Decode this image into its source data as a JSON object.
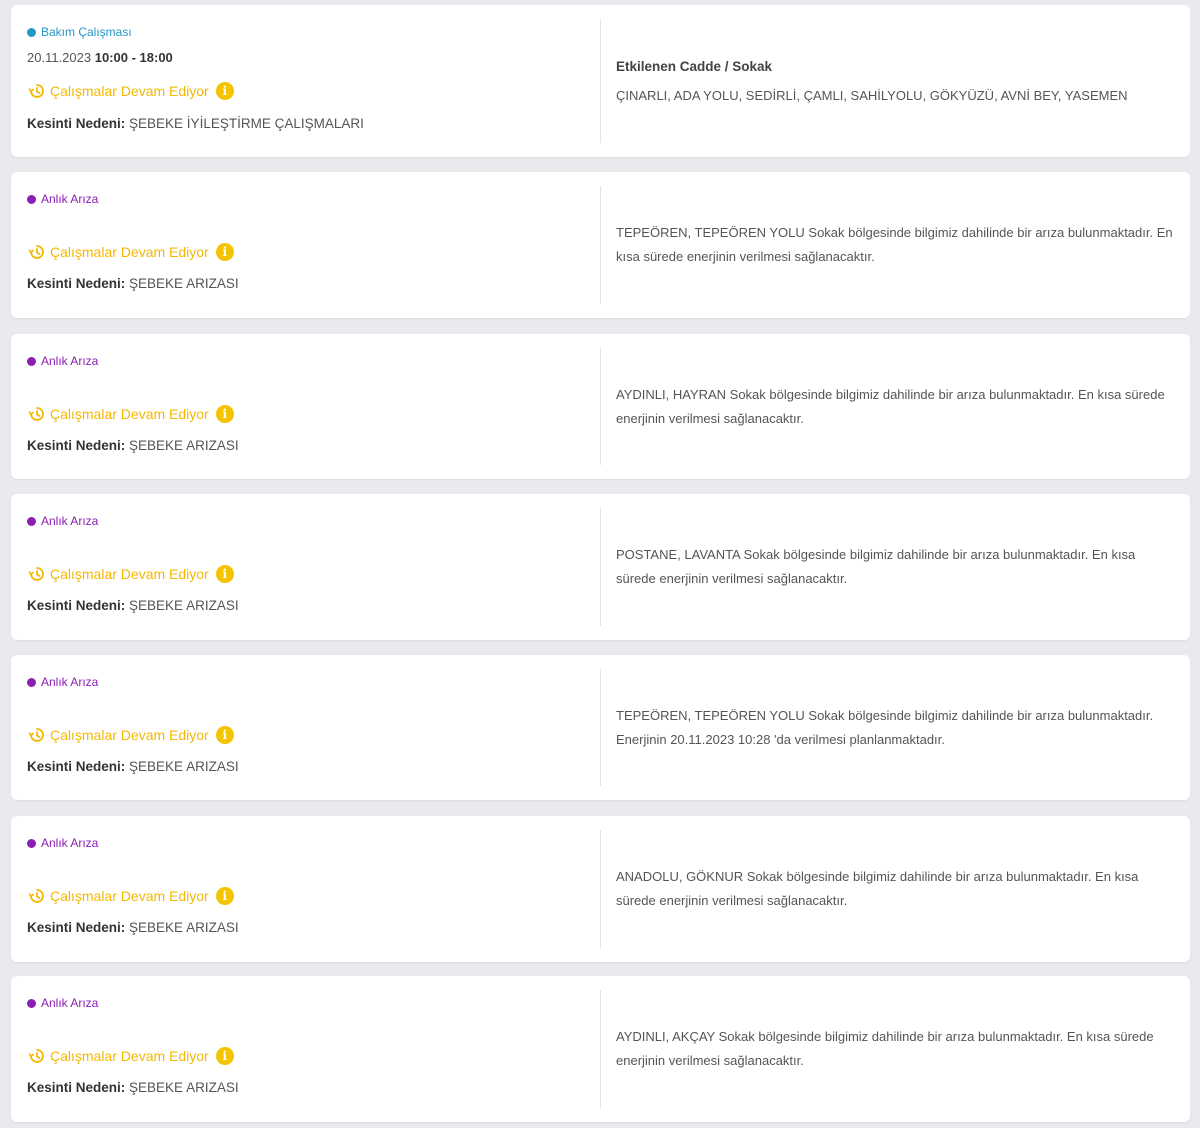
{
  "maintenance": {
    "type_label": "Bakım Çalışması",
    "date": "20.11.2023",
    "time": "10:00 - 18:00",
    "status": "Çalışmalar Devam Ediyor",
    "reason_label": "Kesinti Nedeni:",
    "reason": "ŞEBEKE İYİLEŞTİRME ÇALIŞMALARI",
    "affected_title": "Etkilenen Cadde / Sokak",
    "affected_list": "ÇINARLI, ADA YOLU, SEDİRLİ, ÇAMLI, SAHİLYOLU, GÖKYÜZÜ, AVNİ BEY, YASEMEN"
  },
  "faults": [
    {
      "type_label": "Anlık Arıza",
      "status": "Çalışmalar Devam Ediyor",
      "reason_label": "Kesinti Nedeni:",
      "reason": "ŞEBEKE ARIZASI",
      "description": "TEPEÖREN, TEPEÖREN YOLU Sokak bölgesinde bilgimiz dahilinde bir arıza bulunmaktadır. En kısa sürede enerjinin verilmesi sağlanacaktır."
    },
    {
      "type_label": "Anlık Arıza",
      "status": "Çalışmalar Devam Ediyor",
      "reason_label": "Kesinti Nedeni:",
      "reason": "ŞEBEKE ARIZASI",
      "description": "AYDINLI, HAYRAN Sokak bölgesinde bilgimiz dahilinde bir arıza bulunmaktadır. En kısa sürede enerjinin verilmesi sağlanacaktır."
    },
    {
      "type_label": "Anlık Arıza",
      "status": "Çalışmalar Devam Ediyor",
      "reason_label": "Kesinti Nedeni:",
      "reason": "ŞEBEKE ARIZASI",
      "description": "POSTANE, LAVANTA Sokak bölgesinde bilgimiz dahilinde bir arıza bulunmaktadır. En kısa sürede enerjinin verilmesi sağlanacaktır."
    },
    {
      "type_label": "Anlık Arıza",
      "status": "Çalışmalar Devam Ediyor",
      "reason_label": "Kesinti Nedeni:",
      "reason": "ŞEBEKE ARIZASI",
      "description": "TEPEÖREN, TEPEÖREN YOLU Sokak bölgesinde bilgimiz dahilinde bir arıza bulunmaktadır. Enerjinin 20.11.2023 10:28 'da verilmesi planlanmaktadır."
    },
    {
      "type_label": "Anlık Arıza",
      "status": "Çalışmalar Devam Ediyor",
      "reason_label": "Kesinti Nedeni:",
      "reason": "ŞEBEKE ARIZASI",
      "description": "ANADOLU, GÖKNUR Sokak bölgesinde bilgimiz dahilinde bir arıza bulunmaktadır. En kısa sürede enerjinin verilmesi sağlanacaktır."
    },
    {
      "type_label": "Anlık Arıza",
      "status": "Çalışmalar Devam Ediyor",
      "reason_label": "Kesinti Nedeni:",
      "reason": "ŞEBEKE ARIZASI",
      "description": "AYDINLI, AKÇAY Sokak bölgesinde bilgimiz dahilinde bir arıza bulunmaktadır. En kısa sürede enerjinin verilmesi sağlanacaktır."
    }
  ],
  "colors": {
    "maintenance_dot": "#2596c5",
    "fault_dot": "#8a1fb4",
    "status": "#f5b800",
    "info_badge": "#f5c400"
  },
  "icons": {
    "status": "clock-refresh-icon",
    "info": "info-icon"
  }
}
